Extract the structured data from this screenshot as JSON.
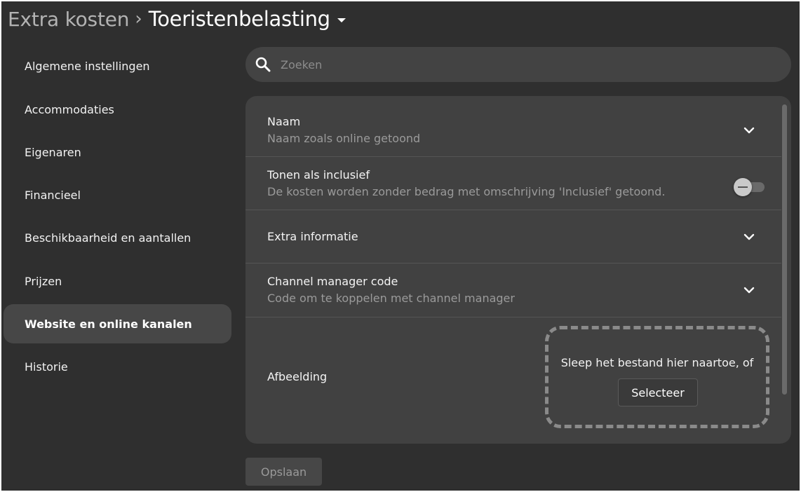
{
  "breadcrumb": {
    "parent": "Extra kosten",
    "separator": "›",
    "current": "Toeristenbelasting"
  },
  "sidebar": {
    "active_index": 6,
    "items": [
      {
        "label": "Algemene instellingen"
      },
      {
        "label": "Accommodaties"
      },
      {
        "label": "Eigenaren"
      },
      {
        "label": "Financieel"
      },
      {
        "label": "Beschikbaarheid en aantallen"
      },
      {
        "label": "Prijzen"
      },
      {
        "label": "Website en online kanalen"
      },
      {
        "label": "Historie"
      }
    ]
  },
  "search": {
    "placeholder": "Zoeken",
    "value": "",
    "icon": "search-icon"
  },
  "settings": {
    "naam": {
      "title": "Naam",
      "subtitle": "Naam zoals online getoond",
      "icon": "chevron-down-icon"
    },
    "inclusief": {
      "title": "Tonen als inclusief",
      "subtitle": "De kosten worden zonder bedrag met omschrijving 'Inclusief' getoond.",
      "enabled": false
    },
    "extra": {
      "title": "Extra informatie",
      "icon": "chevron-down-icon"
    },
    "channel": {
      "title": "Channel manager code",
      "subtitle": "Code om te koppelen met channel manager",
      "icon": "chevron-down-icon"
    },
    "afbeelding": {
      "title": "Afbeelding",
      "drop_text": "Sleep het bestand hier naartoe, of",
      "select_label": "Selecteer"
    }
  },
  "actions": {
    "save_label": "Opslaan",
    "save_enabled": false
  },
  "colors": {
    "background": "#2f2f2f",
    "panel": "#414141",
    "active_item": "#474747",
    "muted_text": "#9a9a9a"
  }
}
